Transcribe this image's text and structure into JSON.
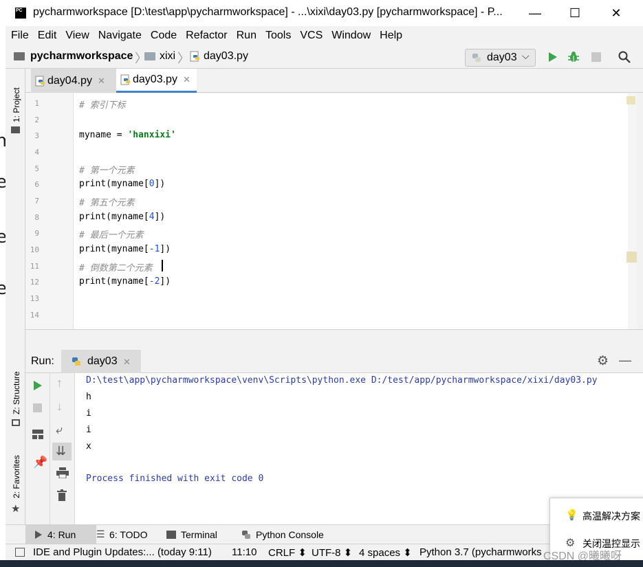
{
  "window": {
    "title": "pycharmworkspace [D:\\test\\app\\pycharmworkspace] - ...\\xixi\\day03.py [pycharmworkspace] - P...",
    "app_icon": "PC",
    "minimize": "—",
    "maximize": "☐",
    "close": "✕"
  },
  "menu": [
    "File",
    "Edit",
    "View",
    "Navigate",
    "Code",
    "Refactor",
    "Run",
    "Tools",
    "VCS",
    "Window",
    "Help"
  ],
  "breadcrumb": {
    "project": "pycharmworkspace",
    "folder": "xixi",
    "file": "day03.py"
  },
  "run_config": {
    "label": "day03",
    "chevron": "⌵"
  },
  "toolbar_icons": [
    "run-icon",
    "debug-icon",
    "stop-icon",
    "search-icon"
  ],
  "left_strip": {
    "project": "1: Project",
    "structure": "Z: Structure",
    "favorites": "2: Favorites"
  },
  "tabs": [
    {
      "label": "day04.py",
      "active": false
    },
    {
      "label": "day03.py",
      "active": true
    }
  ],
  "code_lines": [
    {
      "n": "1",
      "text": "# 索引下标"
    },
    {
      "n": "2",
      "text": ""
    },
    {
      "n": "3",
      "text": "myname = 'hanxixi'"
    },
    {
      "n": "4",
      "text": ""
    },
    {
      "n": "5",
      "text": "# 第一个元素"
    },
    {
      "n": "6",
      "text": "print(myname[0])"
    },
    {
      "n": "7",
      "text": "# 第五个元素"
    },
    {
      "n": "8",
      "text": "print(myname[4])"
    },
    {
      "n": "9",
      "text": "# 最后一个元素"
    },
    {
      "n": "10",
      "text": "print(myname[-1])"
    },
    {
      "n": "11",
      "text": "# 倒数第二个元素"
    },
    {
      "n": "12",
      "text": "print(myname[-2])"
    },
    {
      "n": "13",
      "text": ""
    },
    {
      "n": "14",
      "text": ""
    }
  ],
  "code_parts": {
    "l3_var": "myname = ",
    "l3_str": "'hanxixi'",
    "l6_a": "print(myname[",
    "l6_n": "0",
    "l6_b": "])",
    "l8_a": "print(myname[",
    "l8_n": "4",
    "l8_b": "])",
    "l10_a": "print(myname[",
    "l10_n": "-1",
    "l10_b": "])",
    "l12_a": "print(myname[",
    "l12_n": "-2",
    "l12_b": "])"
  },
  "run_panel": {
    "label": "Run:",
    "tab": "day03",
    "settings_icon": "⚙",
    "hide": "—"
  },
  "console": {
    "command": "D:\\test\\app\\pycharmworkspace\\venv\\Scripts\\python.exe D:/test/app/pycharmworkspace/xixi/day03.py",
    "output": [
      "h",
      "i",
      "i",
      "x"
    ],
    "finished": "Process finished with exit code 0"
  },
  "bottom_tools": [
    {
      "label": "4: Run"
    },
    {
      "label": "6: TODO"
    },
    {
      "label": "Terminal"
    },
    {
      "label": "Python Console"
    }
  ],
  "status": {
    "updates": "IDE and Plugin Updates:... (today 9:11)",
    "position": "11:10",
    "line_sep": "CRLF ⬍",
    "encoding": "UTF-8 ⬍",
    "indent": "4 spaces ⬍",
    "interpreter": "Python 3.7 (pycharmworks"
  },
  "popup": {
    "item1": "高温解决方案",
    "item2": "关闭温控显示"
  },
  "watermark": "CSDN @曦曦呀",
  "colors": {
    "comment": "#8c8c8c",
    "string": "#067d17",
    "number": "#1750eb",
    "run_green": "#3aa54a",
    "console_blue": "#2a3bb0"
  }
}
